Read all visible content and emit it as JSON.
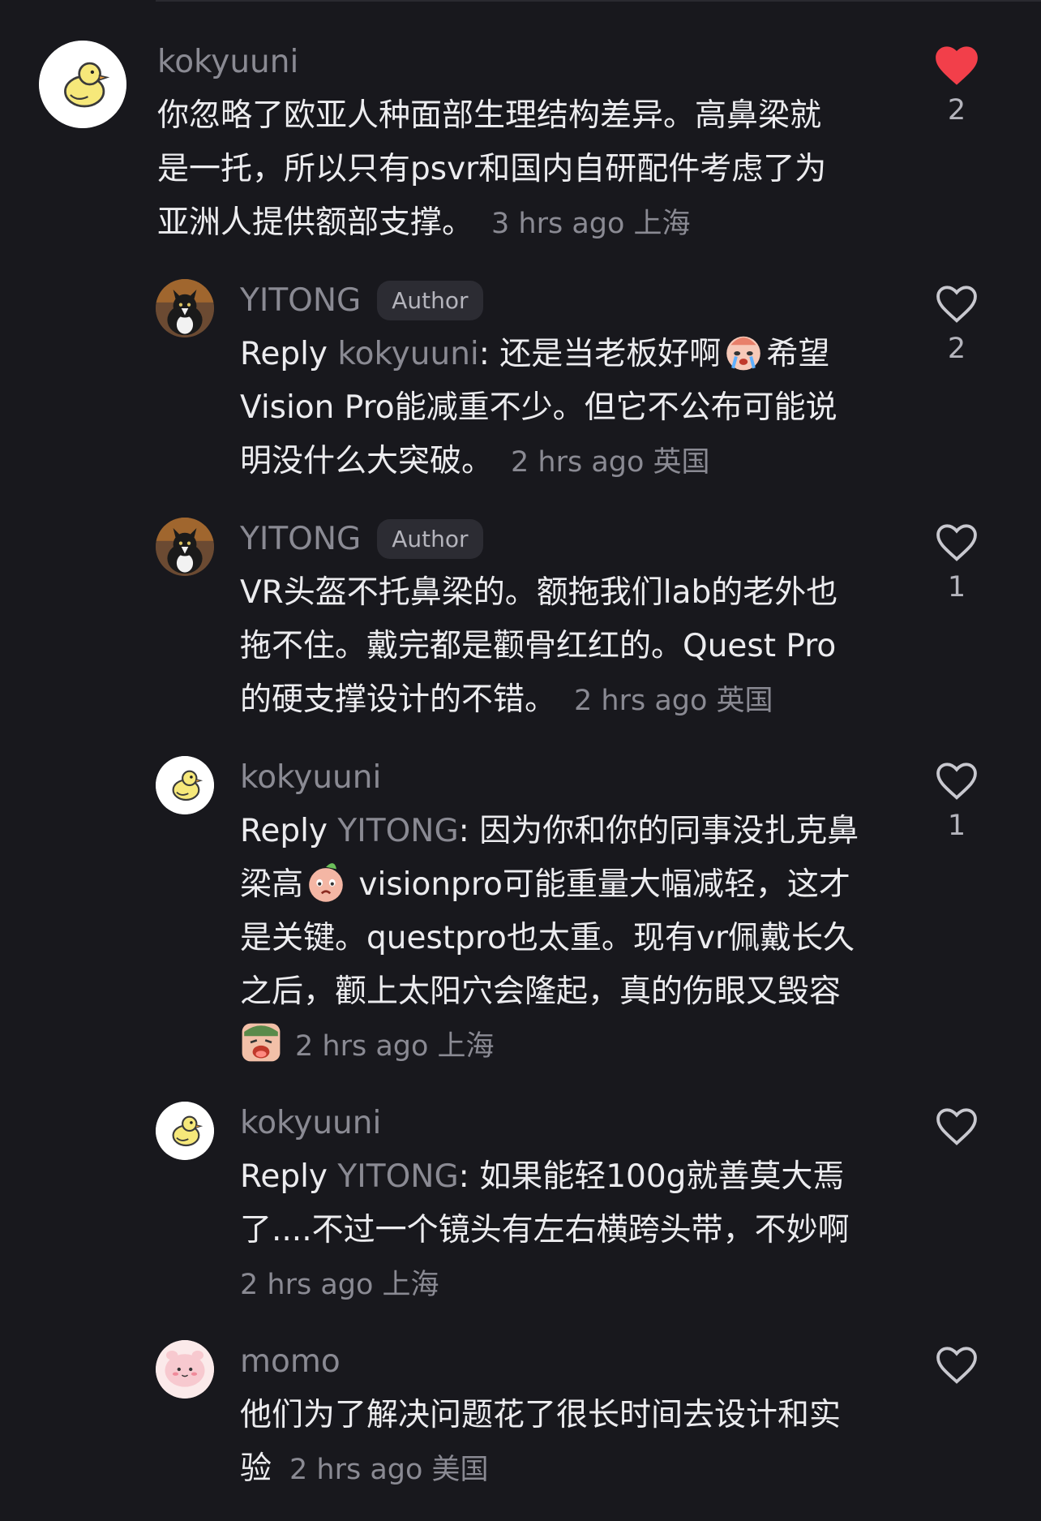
{
  "comments": [
    {
      "username": "kokyuuni",
      "lines": [
        "你忽略了欧亚人种面部生理结构差异。高鼻梁就",
        "是一托，所以只有psvr和国内自研配件考虑了为",
        "亚洲人提供额部支撑。"
      ],
      "meta": "3 hrs ago 上海",
      "likes": "2",
      "liked": true,
      "avatar_icon": "duck-icon"
    },
    {
      "username": "YITONG",
      "badge": "Author",
      "reply_prefix": "Reply ",
      "reply_to": "kokyuuni",
      "reply_sep": ": ",
      "line1_a": "还是当老板好啊",
      "line1_emoji": "crying-face-icon",
      "line1_b": "希望",
      "lines": [
        "Vision Pro能减重不少。但它不公布可能说",
        "明没什么大突破。"
      ],
      "meta": "2 hrs ago 英国",
      "likes": "2",
      "liked": false,
      "avatar_icon": "cat-icon"
    },
    {
      "username": "YITONG",
      "badge": "Author",
      "lines": [
        "VR头盔不托鼻梁的。额拖我们lab的老外也",
        "拖不住。戴完都是颧骨红红的。Quest Pro",
        "的硬支撑设计的不错。"
      ],
      "meta": "2 hrs ago 英国",
      "likes": "1",
      "liked": false,
      "avatar_icon": "cat-icon"
    },
    {
      "username": "kokyuuni",
      "reply_prefix": "Reply ",
      "reply_to": "YITONG",
      "reply_sep": ": ",
      "line1": "因为你和你的同事没扎克鼻",
      "line2_a": "梁高",
      "line2_emoji": "peach-face-icon",
      "line2_b": " visionpro可能重量大幅减轻，这才",
      "lines": [
        "是关键。questpro也太重。现有vr佩戴长久",
        "之后，颧上太阳穴会隆起，真的伤眼又毁容"
      ],
      "last_emoji": "screaming-face-icon",
      "meta": "2 hrs ago 上海",
      "likes": "1",
      "liked": false,
      "avatar_icon": "duck-icon"
    },
    {
      "username": "kokyuuni",
      "reply_prefix": "Reply ",
      "reply_to": "YITONG",
      "reply_sep": ": ",
      "line1": "如果能轻100g就善莫大焉",
      "lines": [
        "了....不过一个镜头有左右横跨头带，不妙啊"
      ],
      "meta": "2 hrs ago 上海",
      "likes": "",
      "liked": false,
      "avatar_icon": "duck-icon"
    },
    {
      "username": "momo",
      "lines": [
        "他们为了解决问题花了很长时间去设计和实",
        "验"
      ],
      "meta": "2 hrs ago 美国",
      "likes": "",
      "liked": false,
      "avatar_icon": "pink-character-icon"
    }
  ],
  "colors": {
    "background": "#18181d",
    "liked_heart": "#f23f4a",
    "muted_text": "#8a8a93"
  }
}
